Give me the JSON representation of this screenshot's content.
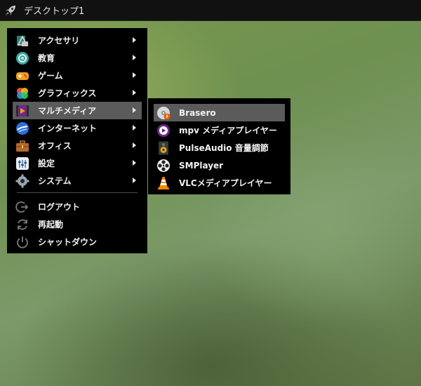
{
  "topbar": {
    "title": "デスクトップ1",
    "launcher_icon": "rocket-icon"
  },
  "main_menu": {
    "categories": [
      {
        "label": "アクセサリ",
        "icon": "accessories-icon",
        "has_submenu": true
      },
      {
        "label": "教育",
        "icon": "education-icon",
        "has_submenu": true
      },
      {
        "label": "ゲーム",
        "icon": "games-icon",
        "has_submenu": true
      },
      {
        "label": "グラフィックス",
        "icon": "graphics-icon",
        "has_submenu": true
      },
      {
        "label": "マルチメディア",
        "icon": "multimedia-icon",
        "has_submenu": true,
        "active": true
      },
      {
        "label": "インターネット",
        "icon": "internet-icon",
        "has_submenu": true
      },
      {
        "label": "オフィス",
        "icon": "office-icon",
        "has_submenu": true
      },
      {
        "label": "設定",
        "icon": "settings-icon",
        "has_submenu": true
      },
      {
        "label": "システム",
        "icon": "system-icon",
        "has_submenu": true
      }
    ],
    "session": [
      {
        "label": "ログアウト",
        "icon": "logout-icon"
      },
      {
        "label": "再起動",
        "icon": "reboot-icon"
      },
      {
        "label": "シャットダウン",
        "icon": "shutdown-icon"
      }
    ]
  },
  "sub_menu": {
    "items": [
      {
        "label": "Brasero",
        "icon": "brasero-icon",
        "active": true
      },
      {
        "label": "mpv メディアプレイヤー",
        "icon": "mpv-icon"
      },
      {
        "label": "PulseAudio 音量調節",
        "icon": "pulseaudio-speaker-icon"
      },
      {
        "label": "SMPlayer",
        "icon": "smplayer-icon"
      },
      {
        "label": "VLCメディアプレイヤー",
        "icon": "vlc-cone-icon"
      }
    ]
  },
  "colors": {
    "menu_bg": "#000000",
    "highlight": "#5b5b5b",
    "topbar_bg": "#111111",
    "text": "#f2f2f2"
  }
}
